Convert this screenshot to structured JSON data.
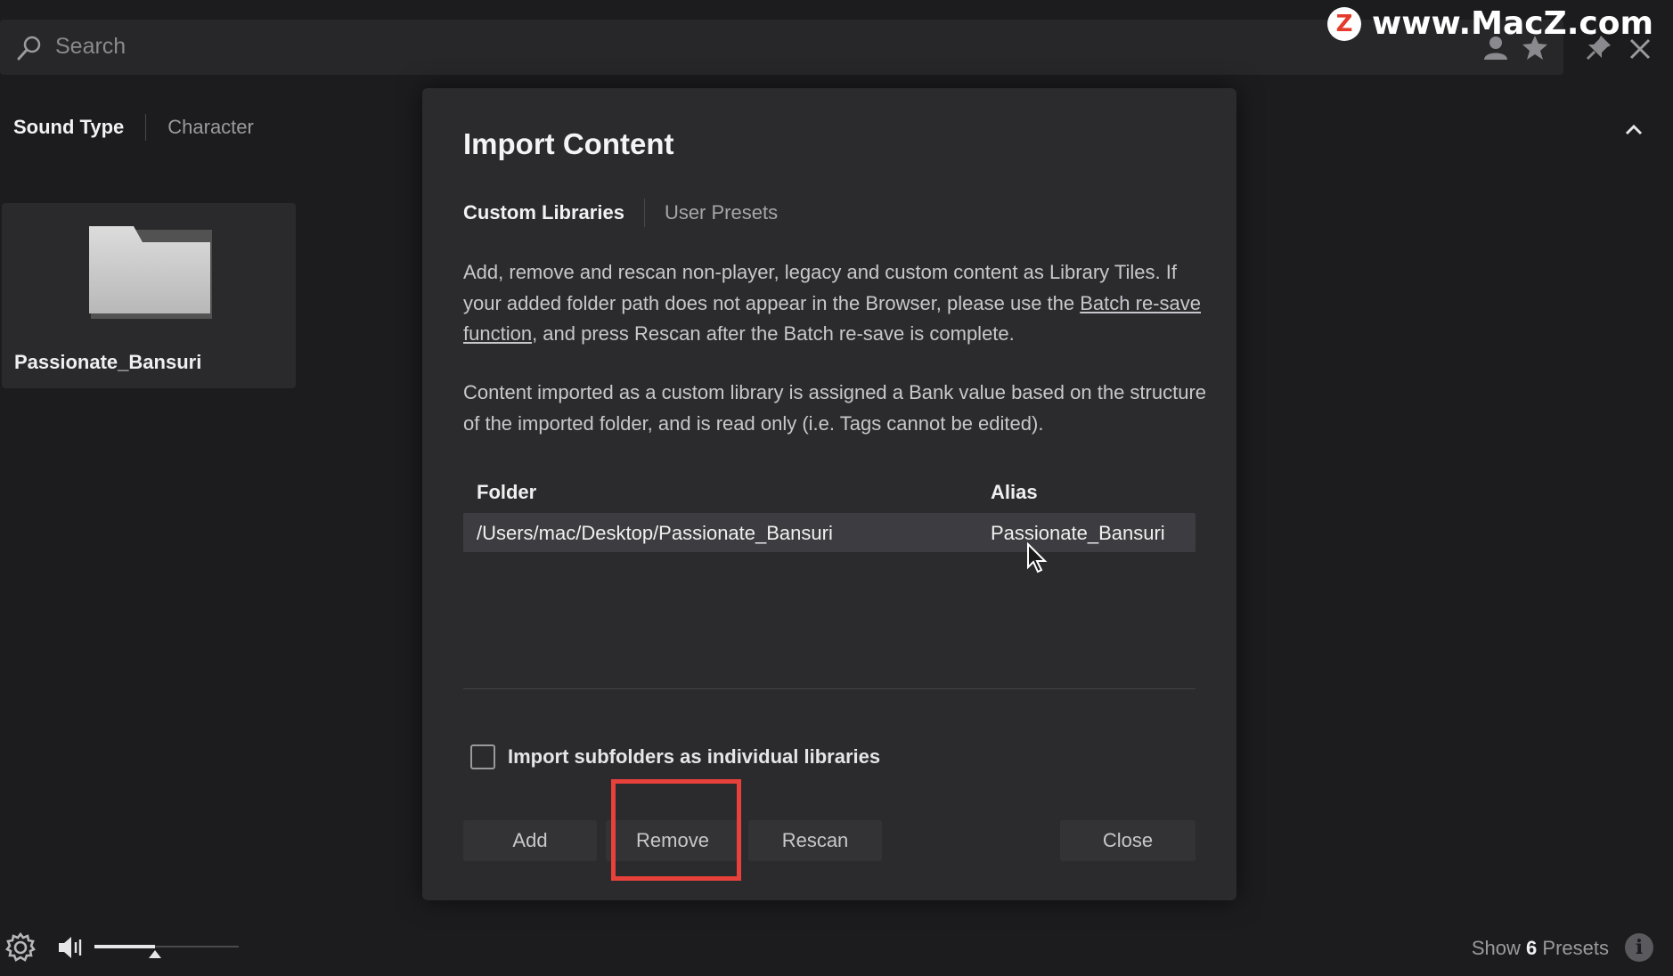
{
  "search": {
    "placeholder": "Search"
  },
  "watermark": {
    "text": "www.MacZ.com",
    "logo_letter": "Z"
  },
  "top_icons": [
    "user-icon",
    "star-icon",
    "pin-icon",
    "close-icon"
  ],
  "left_panel": {
    "filter_tabs": [
      {
        "label": "Sound Type",
        "active": true
      },
      {
        "label": "Character",
        "active": false
      }
    ],
    "library_tile": {
      "label": "Passionate_Bansuri"
    }
  },
  "dialog": {
    "title": "Import Content",
    "tabs": [
      {
        "label": "Custom Libraries",
        "active": true
      },
      {
        "label": "User Presets",
        "active": false
      }
    ],
    "description_1_before_link": "Add, remove and rescan non-player, legacy and custom content as Library Tiles. If your added folder path does not appear in the Browser, please use the ",
    "description_1_link": "Batch re-save function",
    "description_1_after_link": ", and press Rescan after the Batch re-save is complete.",
    "description_2": "Content imported as a custom library is assigned a Bank value based on the structure of the imported folder, and is read only (i.e. Tags cannot be edited).",
    "table": {
      "columns": [
        "Folder",
        "Alias"
      ],
      "rows": [
        {
          "folder": "/Users/mac/Desktop/Passionate_Bansuri",
          "alias": "Passionate_Bansuri"
        }
      ]
    },
    "checkbox": {
      "label": "Import subfolders as individual libraries",
      "checked": false
    },
    "buttons": {
      "add": "Add",
      "remove": "Remove",
      "rescan": "Rescan",
      "close": "Close"
    },
    "highlight_color": "#e8403a"
  },
  "bottom_bar": {
    "volume_level": 0.42,
    "presets_prefix": "Show",
    "presets_count": "6",
    "presets_suffix": "Presets"
  }
}
